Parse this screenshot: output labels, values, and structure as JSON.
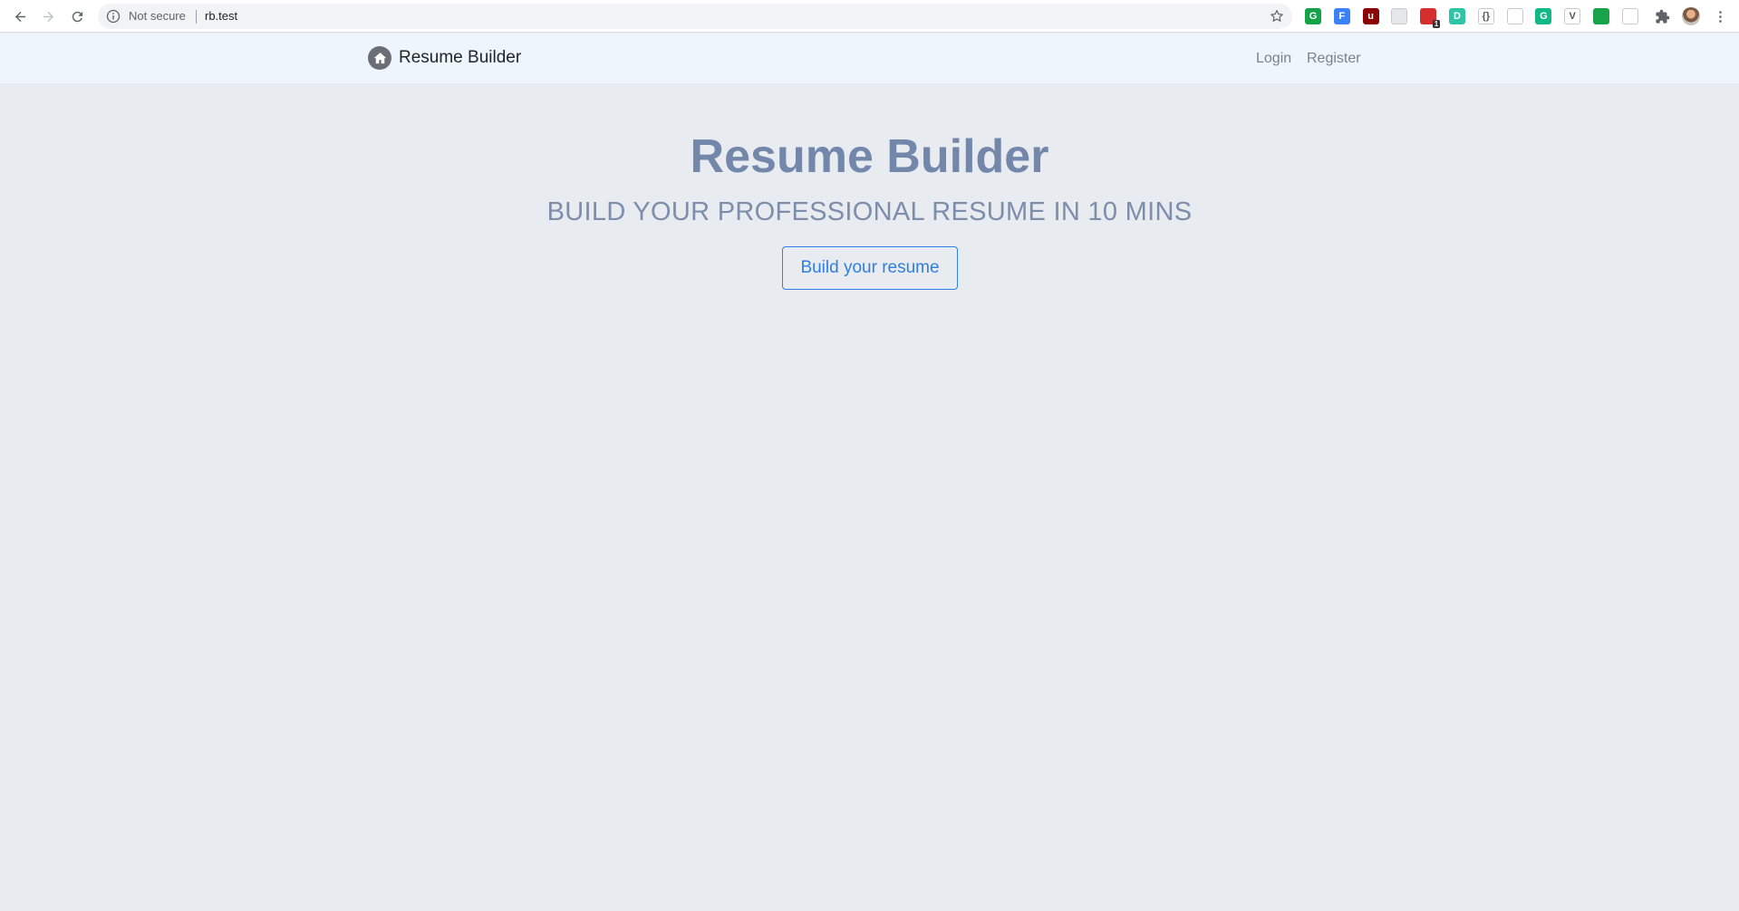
{
  "browser": {
    "security_label": "Not secure",
    "url": "rb.test",
    "extensions": [
      {
        "name": "grammarly-ext-icon",
        "label": "G",
        "color": "#15a34a"
      },
      {
        "name": "formfill-ext-icon",
        "label": "F",
        "color": "#3b82f6"
      },
      {
        "name": "ublock-ext-icon",
        "label": "u",
        "color": "#8b0000"
      },
      {
        "name": "blank-ext-icon",
        "label": "",
        "color": "#e5e7eb"
      },
      {
        "name": "wappalyzer-ext-icon",
        "label": "",
        "color": "#d62d2d",
        "badge": "1"
      },
      {
        "name": "dictionary-ext-icon",
        "label": "D",
        "color": "#2ec4a5"
      },
      {
        "name": "json-ext-icon",
        "label": "{}",
        "color": "#ffffff"
      },
      {
        "name": "keyboard-ext-icon",
        "label": "",
        "color": "#ffffff"
      },
      {
        "name": "grammarly-go-ext-icon",
        "label": "G",
        "color": "#12b886"
      },
      {
        "name": "vue-ext-icon",
        "label": "V",
        "color": "#ffffff"
      },
      {
        "name": "evernote-ext-icon",
        "label": "",
        "color": "#16a34a"
      },
      {
        "name": "cloud-ext-icon",
        "label": "",
        "color": "#ffffff"
      }
    ]
  },
  "navbar": {
    "brand": "Resume Builder",
    "links": [
      "Login",
      "Register"
    ]
  },
  "hero": {
    "title": "Resume Builder",
    "subtitle": "BUILD YOUR PROFESSIONAL RESUME IN 10 MINS",
    "cta": "Build your resume"
  }
}
